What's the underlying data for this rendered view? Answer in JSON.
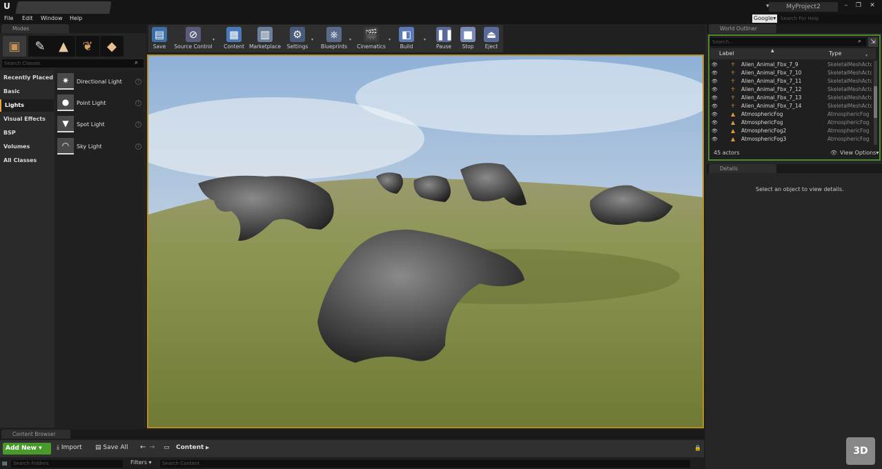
{
  "window": {
    "logo": "U",
    "doc_tab": "",
    "project_name": "MyProject2",
    "controls": [
      "–",
      "❐",
      "✕"
    ]
  },
  "menu": {
    "items": [
      "File",
      "Edit",
      "Window",
      "Help"
    ],
    "search_provider": "Google▾",
    "help_search_placeholder": "Search For Help"
  },
  "modes": {
    "tab_label": "Modes",
    "search_placeholder": "Search Classes",
    "categories": [
      "Recently Placed",
      "Basic",
      "Lights",
      "Visual Effects",
      "BSP",
      "Volumes",
      "All Classes"
    ],
    "active_category": "Lights",
    "items": [
      "Directional Light",
      "Point Light",
      "Spot Light",
      "Sky Light"
    ]
  },
  "toolbar": {
    "buttons": [
      "Save",
      "Source Control",
      "Content",
      "Marketplace",
      "Settings",
      "Blueprints",
      "Cinematics",
      "Build",
      "Pause",
      "Stop",
      "Eject"
    ]
  },
  "outliner": {
    "tab_label": "World Outliner",
    "search_placeholder": "Search...",
    "col_label": "Label",
    "col_type": "Type",
    "rows": [
      {
        "label": "Alien_Animal_Fbx_7_9",
        "type": "SkeletalMeshActo"
      },
      {
        "label": "Alien_Animal_Fbx_7_10",
        "type": "SkeletalMeshActo"
      },
      {
        "label": "Alien_Animal_Fbx_7_11",
        "type": "SkeletalMeshActo"
      },
      {
        "label": "Alien_Animal_Fbx_7_12",
        "type": "SkeletalMeshActo"
      },
      {
        "label": "Alien_Animal_Fbx_7_13",
        "type": "SkeletalMeshActo"
      },
      {
        "label": "Alien_Animal_Fbx_7_14",
        "type": "SkeletalMeshActo"
      },
      {
        "label": "AtmosphericFog",
        "type": "AtmosphericFog"
      },
      {
        "label": "AtmosphericFog",
        "type": "AtmosphericFog"
      },
      {
        "label": "AtmosphericFog2",
        "type": "AtmosphericFog"
      },
      {
        "label": "AtmosphericFog3",
        "type": "AtmosphericFog"
      }
    ],
    "actor_count": "45 actors",
    "view_options": "View Options▾"
  },
  "details": {
    "tab_label": "Details",
    "empty_message": "Select an object to view details."
  },
  "content_browser": {
    "tab_label": "Content Browser",
    "add_new": "Add New ▾",
    "import": "Import",
    "save_all": "Save All",
    "path": "Content",
    "search_folders_placeholder": "Search Folders",
    "filters": "Filters ▾",
    "search_content_placeholder": "Search Content"
  },
  "colors": {
    "viewport_border": "#b88f1e",
    "outliner_border": "#4a8c2b",
    "add_new": "#4a9a2b",
    "active_category_accent": "#e6a53a"
  }
}
